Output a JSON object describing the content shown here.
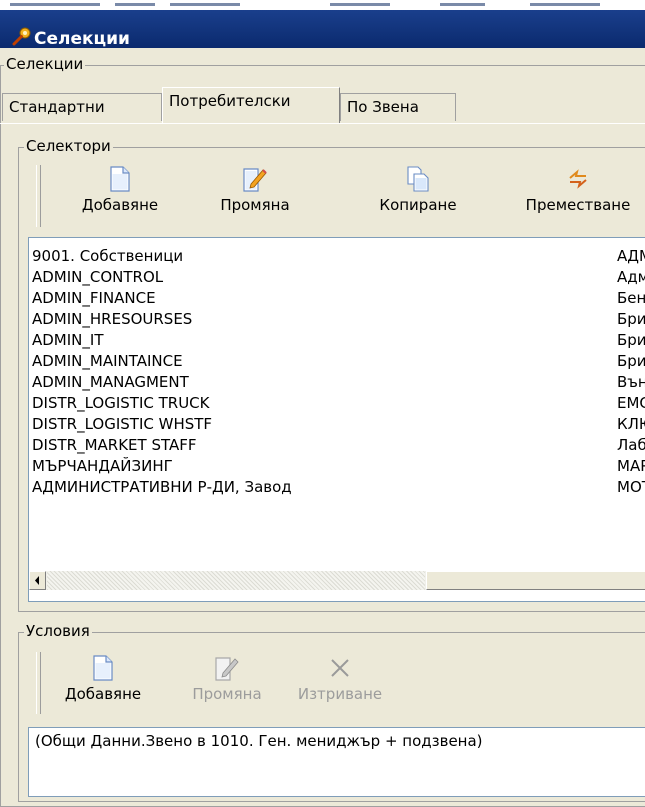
{
  "window": {
    "title": "Селекции",
    "title_icon": "magnifier-key-icon"
  },
  "outer_group": {
    "label": "Селекции"
  },
  "tabs": [
    {
      "label": "Стандартни",
      "active": false
    },
    {
      "label": "Потребителски",
      "active": true
    },
    {
      "label": "По Звена",
      "active": false
    }
  ],
  "selectors": {
    "label": "Селектори",
    "toolbar": {
      "add": "Добавяне",
      "edit": "Промяна",
      "copy": "Копиране",
      "move": "Преместване"
    },
    "rows": [
      {
        "name": "9001. Собственици",
        "col2": "АДМ"
      },
      {
        "name": "ADMIN_CONTROL",
        "col2": "Адм"
      },
      {
        "name": "ADMIN_FINANCE",
        "col2": "Бен:"
      },
      {
        "name": "ADMIN_HRESOURSES",
        "col2": "Бри"
      },
      {
        "name": "ADMIN_IT",
        "col2": "Бри"
      },
      {
        "name": "ADMIN_MAINTAINCE",
        "col2": "Бри"
      },
      {
        "name": "ADMIN_MANAGMENT",
        "col2": "Вън"
      },
      {
        "name": "DISTR_LOGISTIC TRUCK",
        "col2": "ЕМС"
      },
      {
        "name": "DISTR_LOGISTIC WHSTF",
        "col2": "КЛЮ"
      },
      {
        "name": "DISTR_MARKET STAFF",
        "col2": "Лаб"
      },
      {
        "name": "МЪРЧАНДАЙЗИНГ",
        "col2": "МАР"
      },
      {
        "name": "АДМИНИСТРАТИВНИ Р-ДИ, Завод",
        "col2": "МОТ"
      }
    ]
  },
  "conditions": {
    "label": "Условия",
    "toolbar": {
      "add": "Добавяне",
      "edit": "Промяна",
      "delete": "Изтриване"
    },
    "text": "(Общи Данни.Звено в 1010. Ген. мениджър + подзвена)"
  },
  "colors": {
    "title_bar": "#0b2a6e",
    "window_bg": "#ece9d8",
    "disabled_text": "#9c9c9c"
  }
}
